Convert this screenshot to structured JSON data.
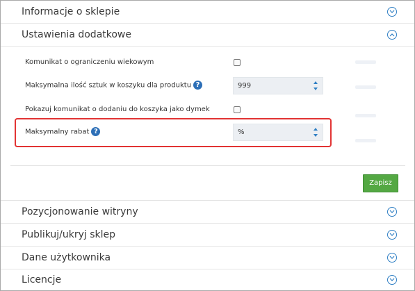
{
  "sections": {
    "store_info": "Informacje o sklepie",
    "additional_settings": "Ustawienia dodatkowe",
    "seo": "Pozycjonowanie witryny",
    "publish": "Publikuj/ukryj sklep",
    "user_data": "Dane użytkownika",
    "licenses": "Licencje"
  },
  "settings": {
    "age_limit_label": "Komunikat o ograniczeniu wiekowym",
    "max_qty_label": "Maksymalna ilość sztuk w koszyku dla produktu",
    "max_qty_value": "999",
    "cart_message_label": "Pokazuj komunikat o dodaniu do koszyka jako dymek",
    "max_discount_label": "Maksymalny rabat",
    "max_discount_placeholder": "%",
    "help_glyph": "?"
  },
  "actions": {
    "save_label": "Zapisz"
  },
  "colors": {
    "accent_blue": "#2f7fc4",
    "save_green": "#54a843",
    "highlight_red": "#e23333"
  }
}
